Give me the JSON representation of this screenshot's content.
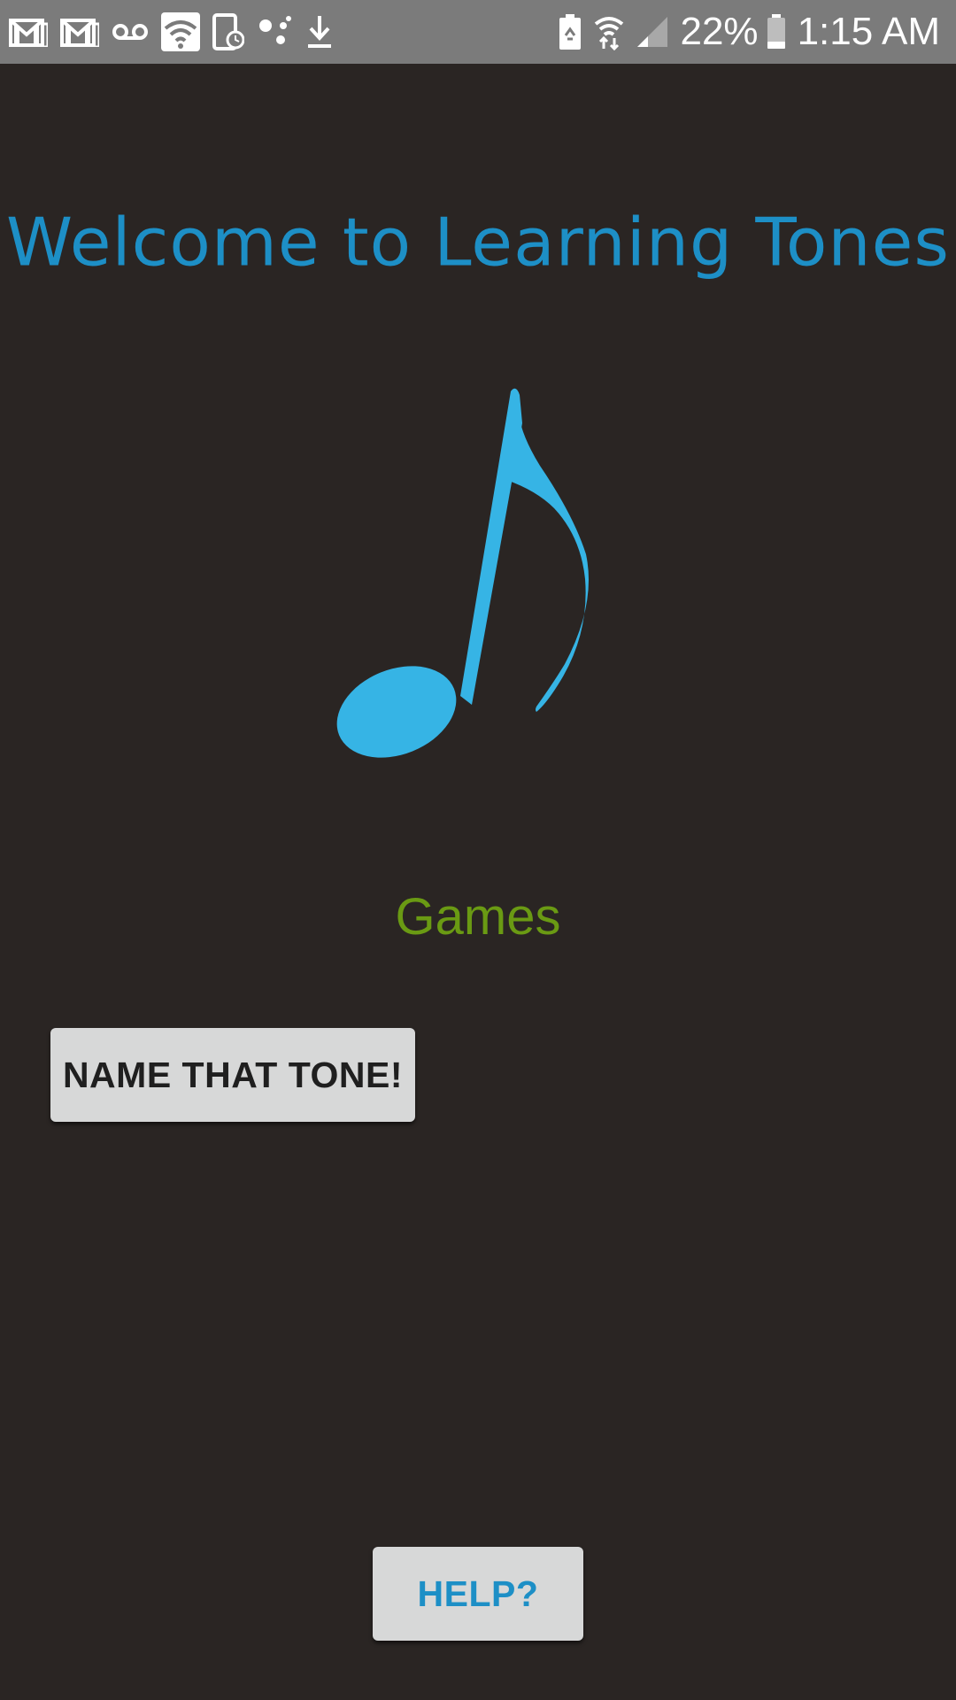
{
  "status_bar": {
    "icons_left": [
      "gmail-icon",
      "gmail-icon",
      "voicemail-icon",
      "wifi-icon",
      "phone-clock-icon",
      "assistant-dots-icon",
      "download-icon"
    ],
    "icons_right": [
      "battery-saver-icon",
      "wifi-calling-icon",
      "signal-icon",
      "battery-icon"
    ],
    "battery_percent": "22%",
    "time": "1:15 AM"
  },
  "main": {
    "title": "Welcome to Learning Tones",
    "logo_icon": "music-note-icon",
    "games_label": "Games",
    "name_that_tone_button": "NAME THAT TONE!",
    "help_button": "HELP?"
  },
  "colors": {
    "background": "#2a2523",
    "status_bar": "#7b7b7b",
    "title": "#1d8fc6",
    "note": "#36b4e5",
    "games_label": "#6a9a13",
    "button_bg": "#d7d8d8",
    "help_text": "#1d8fc6"
  }
}
